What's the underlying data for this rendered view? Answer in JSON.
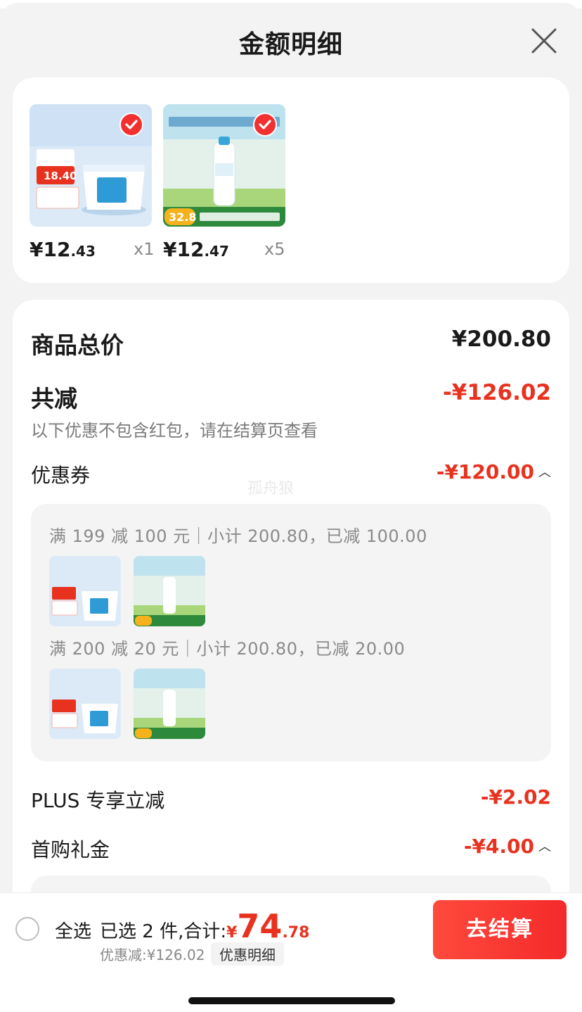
{
  "header": {
    "title": "金额明细"
  },
  "products": [
    {
      "price_int": "¥12",
      "price_dec": ".43",
      "qty": "x1",
      "image": "yogurt-tub-product",
      "badge": "18.40"
    },
    {
      "price_int": "¥12",
      "price_dec": ".47",
      "qty": "x5",
      "image": "milk-bottle-product",
      "badge": "32.8"
    }
  ],
  "summary": {
    "total_label": "商品总价",
    "total_value": "¥200.80",
    "reduce_label": "共减",
    "reduce_value": "-¥126.02",
    "note": "以下优惠不包含红包，请在结算页查看"
  },
  "coupon": {
    "label": "优惠券",
    "value": "-¥120.00",
    "lines": [
      "满 199 减 100 元｜小计 200.80，已减 100.00",
      "满 200 减 20 元｜小计 200.80，已减 20.00"
    ]
  },
  "plus": {
    "label": "PLUS 专享立减",
    "value": "-¥2.02"
  },
  "first": {
    "label": "首购礼金",
    "value": "-¥4.00"
  },
  "watermark": "孤舟狼",
  "bottom": {
    "select_all": "全选",
    "selected": "已选 2 件,合计:",
    "currency": "¥",
    "total_int": "74",
    "total_dec": ".78",
    "discount": "优惠减:¥126.02",
    "detail_link": "优惠明细",
    "checkout": "去结算"
  },
  "colors": {
    "accent": "#e8321f",
    "checkout": "#f42a2a"
  }
}
